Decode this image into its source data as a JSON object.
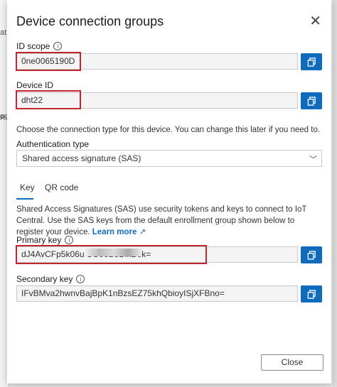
{
  "background": {
    "left_fragments": [
      "at",
      "ec",
      "Ra"
    ]
  },
  "dialog": {
    "title": "Device connection groups",
    "close_glyph": "✕",
    "id_scope": {
      "label": "ID scope",
      "value": "0ne0065190D"
    },
    "device_id": {
      "label": "Device ID",
      "value": "dht22"
    },
    "connection_hint": "Choose the connection type for this device. You can change this later if you need to.",
    "auth": {
      "label": "Authentication type",
      "selected": "Shared access signature (SAS)"
    },
    "tabs": [
      {
        "label": "Key"
      },
      {
        "label": "QR code"
      }
    ],
    "sas_description": "Shared Access Signatures (SAS) use security tokens and keys to connect to IoT Central. Use the SAS keys from the default enrollment group shown below to register your device.",
    "learn_more": "Learn more",
    "primary_key": {
      "label": "Primary key",
      "value": "dJ4AvCFp5k06u                        SG06B5BfkBek="
    },
    "secondary_key": {
      "label": "Secondary key",
      "value": "IFvBMva2hwnvBajBpK1nBzsEZ75khQbioyISjXFBno="
    },
    "close_button": "Close"
  },
  "colors": {
    "accent": "#0f6cbd",
    "highlight": "#c0262d"
  },
  "icons": {
    "copy": "copy-icon",
    "info": "info-icon",
    "external": "external-link-icon",
    "chevron": "chevron-down-icon"
  }
}
